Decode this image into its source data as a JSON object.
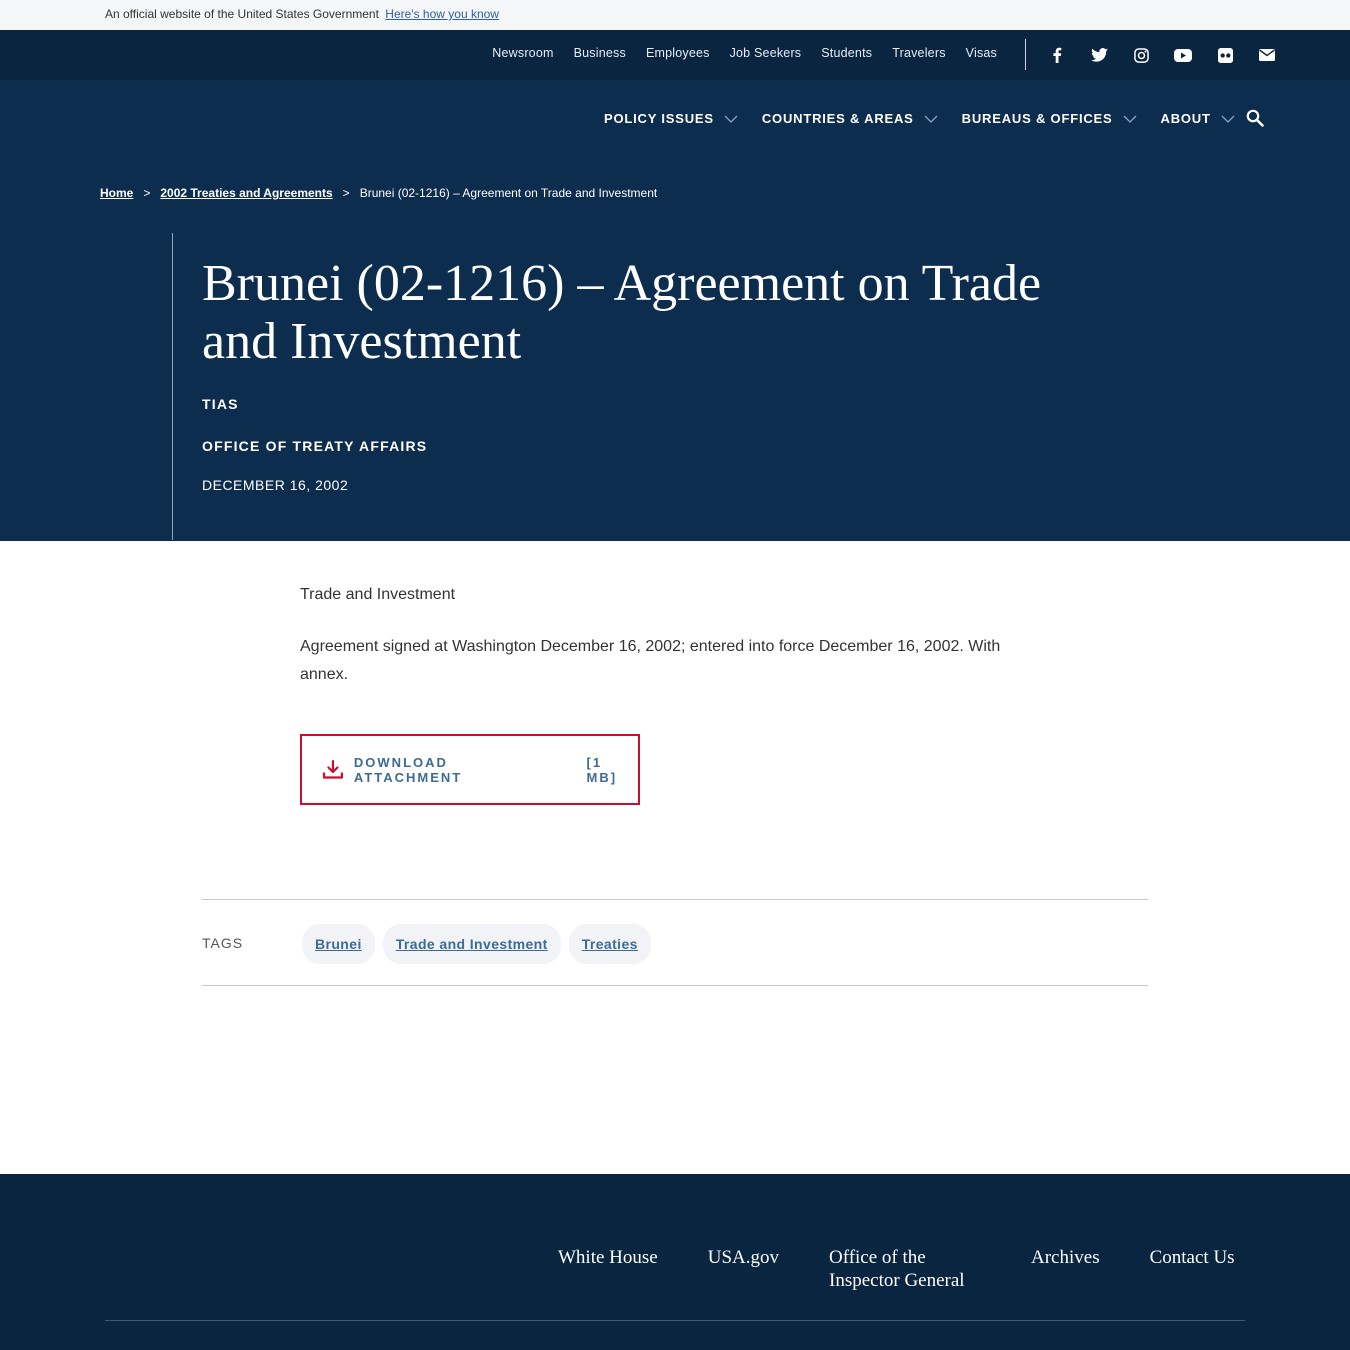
{
  "gov_banner": {
    "text": "An official website of the United States Government",
    "link": "Here's how you know"
  },
  "utility_nav": {
    "links": [
      "Newsroom",
      "Business",
      "Employees",
      "Job Seekers",
      "Students",
      "Travelers",
      "Visas"
    ],
    "social_icons": [
      "facebook-icon",
      "twitter-icon",
      "instagram-icon",
      "youtube-icon",
      "flickr-icon",
      "email-icon"
    ]
  },
  "main_nav": {
    "items": [
      "POLICY ISSUES",
      "COUNTRIES & AREAS",
      "BUREAUS & OFFICES",
      "ABOUT"
    ]
  },
  "breadcrumb": {
    "home": "Home",
    "parent": "2002 Treaties and Agreements",
    "current": "Brunei (02-1216) – Agreement on Trade and Investment",
    "separator": ">"
  },
  "page": {
    "title": "Brunei (02-1216) – Agreement on Trade and Investment",
    "category": "TIAS",
    "office": "OFFICE OF TREATY AFFAIRS",
    "date": "DECEMBER 16, 2002"
  },
  "content": {
    "paragraph_1": "Trade and Investment",
    "paragraph_2": "Agreement signed at Washington December 16, 2002; entered into force December 16, 2002. With annex."
  },
  "download": {
    "label": "DOWNLOAD ATTACHMENT",
    "size": "[1 MB]"
  },
  "tags": {
    "label": "TAGS",
    "items": [
      "Brunei",
      "Trade and Investment",
      "Treaties"
    ]
  },
  "footer": {
    "links": [
      "White House",
      "USA.gov",
      "Office of the Inspector General",
      "Archives",
      "Contact Us"
    ]
  },
  "colors": {
    "navy_dark": "#0a2540",
    "navy_hero": "#0d2d4f",
    "accent_red": "#c8102e",
    "link_blue": "#3d6b96"
  }
}
